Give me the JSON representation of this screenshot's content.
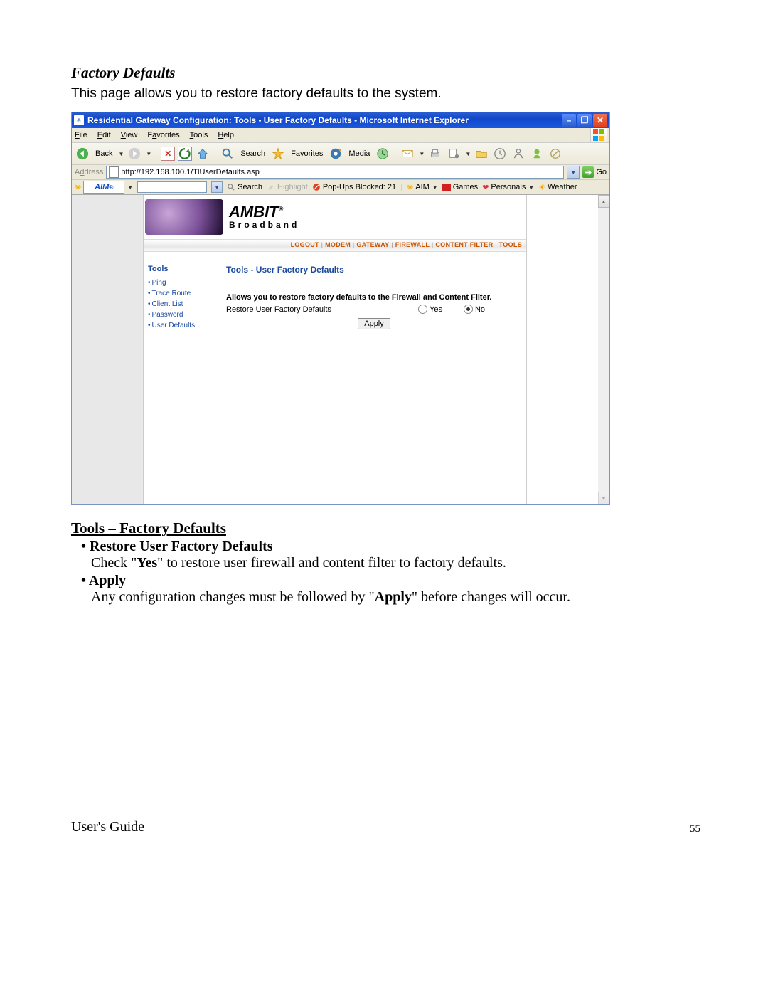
{
  "doc": {
    "section_title": "Factory Defaults",
    "section_intro": "This page allows you to restore factory defaults to the system.",
    "subheading": "Tools – Factory Defaults",
    "bullet1_title": "Restore User Factory Defaults",
    "bullet1_text_a": "Check \"",
    "bullet1_text_yes": "Yes",
    "bullet1_text_b": "\" to restore user firewall and content filter to factory defaults.",
    "bullet2_title": "Apply",
    "bullet2_text_a": "Any configuration changes must be followed by \"",
    "bullet2_text_apply": "Apply",
    "bullet2_text_b": "\" before changes will occur.",
    "footer_left": "User's Guide",
    "footer_right": "55"
  },
  "ie": {
    "title": "Residential Gateway Configuration: Tools - User Factory Defaults - Microsoft Internet Explorer",
    "menu": {
      "file": "File",
      "edit": "Edit",
      "view": "View",
      "favorites": "Favorites",
      "tools": "Tools",
      "help": "Help"
    },
    "toolbar": {
      "back": "Back",
      "search": "Search",
      "favorites": "Favorites",
      "media": "Media"
    },
    "address_label": "Address",
    "url": "http://192.168.100.1/TlUserDefaults.asp",
    "go": "Go",
    "aim": {
      "brand": "AIM",
      "search": "Search",
      "highlight": "Highlight",
      "popups": "Pop-Ups Blocked: 21",
      "aim_label": "AIM",
      "games": "Games",
      "personals": "Personals",
      "weather": "Weather"
    }
  },
  "gateway": {
    "brand_top": "AMBIT",
    "brand_bottom": "Broadband",
    "nav": {
      "logout": "LOGOUT",
      "modem": "MODEM",
      "gateway": "GATEWAY",
      "firewall": "FIREWALL",
      "content_filter": "CONTENT FILTER",
      "tools": "TOOLS"
    },
    "side": {
      "heading": "Tools",
      "ping": "Ping",
      "trace": "Trace Route",
      "clients": "Client List",
      "password": "Password",
      "defaults": "User Defaults"
    },
    "main": {
      "title": "Tools - User Factory Defaults",
      "desc": "Allows you to restore factory defaults to the Firewall and Content Filter.",
      "row_label": "Restore User Factory Defaults",
      "yes": "Yes",
      "no": "No",
      "apply": "Apply"
    }
  }
}
